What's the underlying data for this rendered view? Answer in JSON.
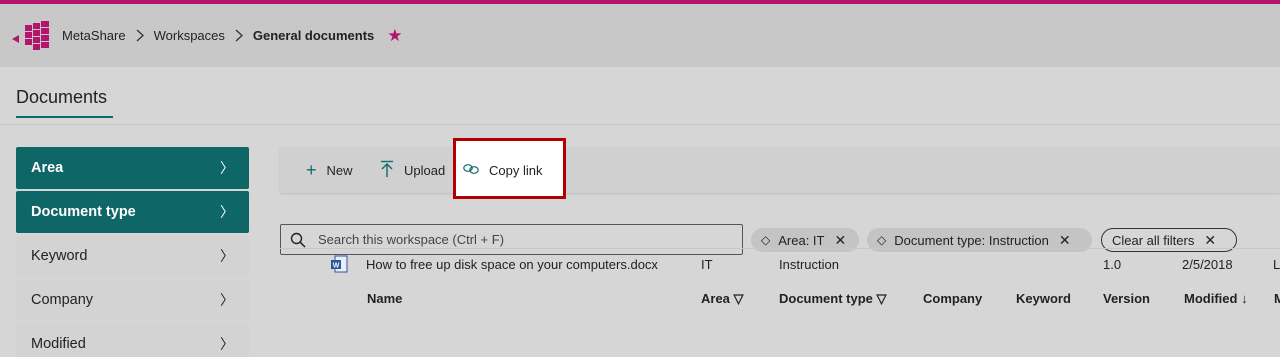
{
  "colors": {
    "brand": "#b4146e",
    "accent": "#0f6666",
    "highlight": "#b00000"
  },
  "breadcrumb": {
    "items": [
      "MetaShare",
      "Workspaces",
      "General documents"
    ],
    "separator_icon": "chevron-right-icon",
    "favorite_icon": "star-icon"
  },
  "page": {
    "title": "Documents"
  },
  "sidebar": {
    "items": [
      {
        "label": "Area",
        "active": true
      },
      {
        "label": "Document type",
        "active": true
      },
      {
        "label": "Keyword",
        "active": false
      },
      {
        "label": "Company",
        "active": false
      },
      {
        "label": "Modified",
        "active": false
      }
    ]
  },
  "commandbar": {
    "new_label": "New",
    "upload_label": "Upload",
    "copy_link_label": "Copy link",
    "new_icon": "plus-icon",
    "upload_icon": "upload-icon",
    "copy_link_icon": "link-icon"
  },
  "search": {
    "placeholder": "Search this workspace (Ctrl + F)",
    "value": ""
  },
  "filters": {
    "chips": [
      "Area: IT",
      "Document type: Instruction"
    ],
    "clear_label": "Clear all filters"
  },
  "table": {
    "columns": [
      "Name",
      "Area",
      "Document type",
      "Company",
      "Keyword",
      "Version",
      "Modified",
      "M"
    ],
    "rows": [
      {
        "name": "How to free up disk space on your computers.docx",
        "area": "IT",
        "document_type": "Instruction",
        "company": "",
        "keyword": "",
        "version": "1.0",
        "modified": "2/5/2018",
        "m": "L"
      }
    ]
  }
}
